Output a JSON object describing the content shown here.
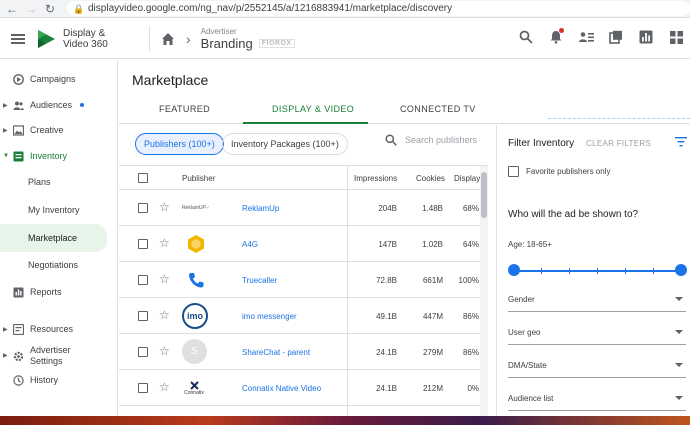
{
  "browser": {
    "url": "displayvideo.google.com/ng_nav/p/2552145/a/1216883941/marketplace/discovery"
  },
  "header": {
    "product_line1": "Display &",
    "product_line2": "Video 360",
    "advertiser_caption": "Advertiser",
    "advertiser_name": "Branding",
    "advertiser_logo_text": "FIOROX"
  },
  "sidebar": {
    "items": [
      {
        "label": "Campaigns",
        "icon": "campaigns-icon"
      },
      {
        "label": "Audiences",
        "icon": "audiences-icon"
      },
      {
        "label": "Creative",
        "icon": "creative-icon"
      },
      {
        "label": "Inventory",
        "icon": "inventory-icon"
      },
      {
        "label": "Plans"
      },
      {
        "label": "My Inventory"
      },
      {
        "label": "Marketplace"
      },
      {
        "label": "Negotiations"
      },
      {
        "label": "Reports",
        "icon": "reports-icon"
      },
      {
        "label": "Resources",
        "icon": "resources-icon"
      },
      {
        "label": "Advertiser",
        "label2": "Settings",
        "icon": "settings-icon"
      },
      {
        "label": "History",
        "icon": "history-icon"
      }
    ]
  },
  "main": {
    "title": "Marketplace",
    "tabs": [
      "FEATURED",
      "DISPLAY & VIDEO",
      "CONNECTED TV"
    ],
    "active_tab": 1,
    "chips": [
      "Publishers (100+)",
      "Inventory Packages (100+)"
    ],
    "search_placeholder": "Search publishers"
  },
  "table": {
    "headers": {
      "publisher": "Publisher",
      "impressions": "Impressions",
      "cookies": "Cookies",
      "display": "Display"
    },
    "rows": [
      {
        "name": "ReklamUp",
        "impressions": "204B",
        "cookies": "1.48B",
        "display": "68%",
        "logo": "reklamup"
      },
      {
        "name": "A4G",
        "impressions": "147B",
        "cookies": "1.02B",
        "display": "64%",
        "logo": "a4g"
      },
      {
        "name": "Truecaller",
        "impressions": "72.8B",
        "cookies": "661M",
        "display": "100%",
        "logo": "truecaller"
      },
      {
        "name": "imo messenger",
        "impressions": "49.1B",
        "cookies": "447M",
        "display": "86%",
        "logo": "imo"
      },
      {
        "name": "ShareChat - parent",
        "impressions": "24.1B",
        "cookies": "279M",
        "display": "86%",
        "logo": "sharechat"
      },
      {
        "name": "Connatix Native Video",
        "impressions": "24.1B",
        "cookies": "212M",
        "display": "0%",
        "logo": "connatix"
      }
    ],
    "logo_texts": {
      "reklamup": "ReklamUP",
      "imo": "imo",
      "sharechat": "S",
      "connatix": "Connatix"
    }
  },
  "filter": {
    "title": "Filter Inventory",
    "clear": "CLEAR FILTERS",
    "favorite_label": "Favorite publishers only",
    "question": "Who will the ad be shown to?",
    "age": "Age: 18-65+",
    "selects": [
      "Gender",
      "User geo",
      "DMA/State",
      "Audience list"
    ]
  },
  "colors": {
    "accent_green": "#188038",
    "link_blue": "#1a73e8"
  }
}
